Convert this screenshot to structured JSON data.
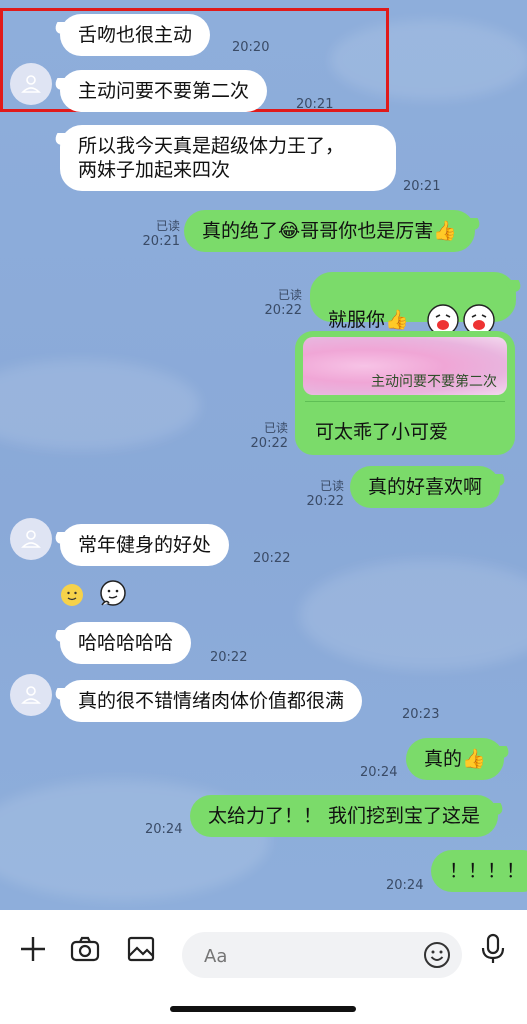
{
  "messages": [
    {
      "text": "舌吻也很主动",
      "time": "20:20"
    },
    {
      "text": "主动问要不要第二次",
      "time": "20:21"
    },
    {
      "text": "所以我今天真是超级体力王了，\n两妹子加起来四次",
      "time": "20:21"
    },
    {
      "text": "真的绝了😂哥哥你也是厉害👍",
      "read": "已读",
      "time": "20:21"
    },
    {
      "text": "就服你👍",
      "read": "已读",
      "time": "20:22"
    },
    {
      "quote": "主动问要不要第二次",
      "text": "可太乖了小可爱",
      "read": "已读",
      "time": "20:22"
    },
    {
      "text": "真的好喜欢啊",
      "read": "已读",
      "time": "20:22"
    },
    {
      "text": "常年健身的好处",
      "time": "20:22"
    },
    {
      "text": "哈哈哈哈哈",
      "time": "20:22"
    },
    {
      "text": "真的很不错情绪肉体价值都很满",
      "time": "20:23"
    },
    {
      "text": "真的👍",
      "time": "20:24"
    },
    {
      "text": "太给力了！！ 我们挖到宝了这是",
      "time": "20:24"
    },
    {
      "text": "！！！！",
      "time": "20:24"
    }
  ],
  "input": {
    "placeholder": "Aa"
  },
  "icons": {
    "plus": "plus-icon",
    "camera": "camera-icon",
    "image": "image-icon",
    "emoji": "emoji-icon",
    "mic": "microphone-icon"
  },
  "colors": {
    "incoming": "#ffffff",
    "outgoing": "#7bdb6a",
    "background": "#8eaedb",
    "highlight": "#e01a1a"
  }
}
